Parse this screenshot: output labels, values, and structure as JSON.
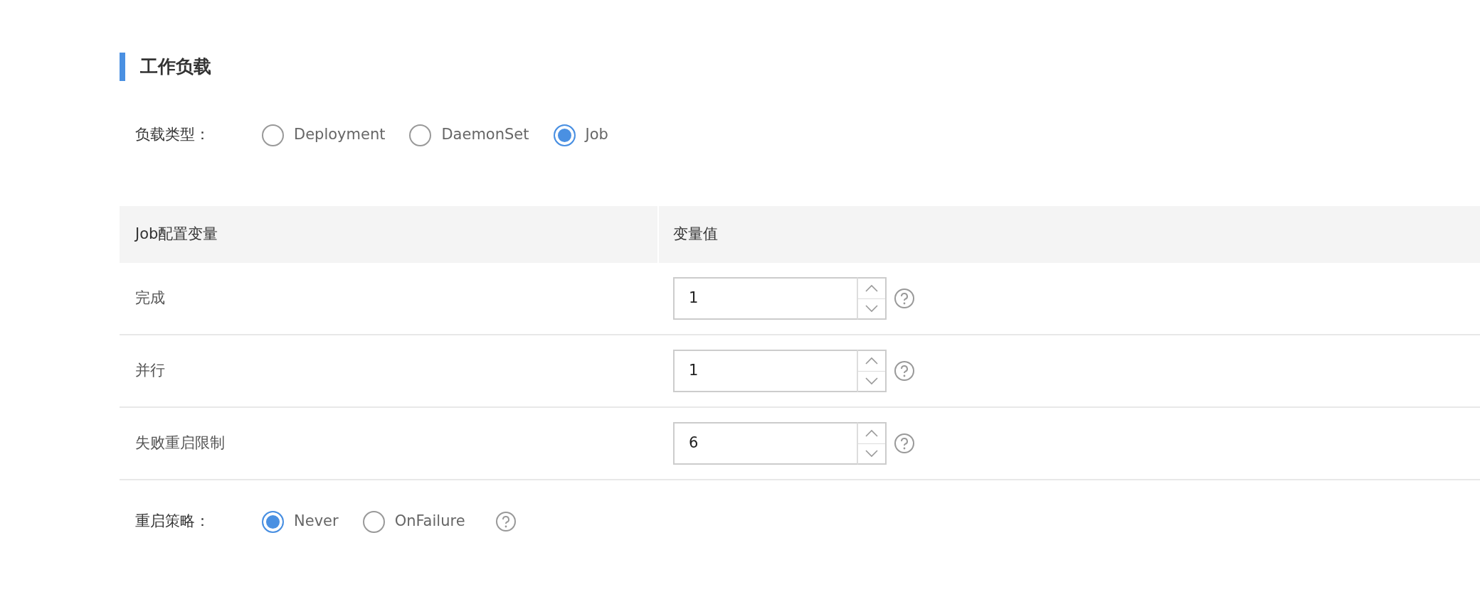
{
  "section": {
    "title": "工作负载"
  },
  "workload_type": {
    "label": "负载类型：",
    "options": [
      {
        "label": "Deployment",
        "selected": false
      },
      {
        "label": "DaemonSet",
        "selected": false
      },
      {
        "label": "Job",
        "selected": true
      }
    ]
  },
  "table": {
    "columns": [
      "Job配置变量",
      "变量值"
    ],
    "rows": [
      {
        "name": "完成",
        "value": "1"
      },
      {
        "name": "并行",
        "value": "1"
      },
      {
        "name": "失败重启限制",
        "value": "6"
      }
    ]
  },
  "restart_policy": {
    "label": "重启策略：",
    "options": [
      {
        "label": "Never",
        "selected": true
      },
      {
        "label": "OnFailure",
        "selected": false
      }
    ]
  }
}
